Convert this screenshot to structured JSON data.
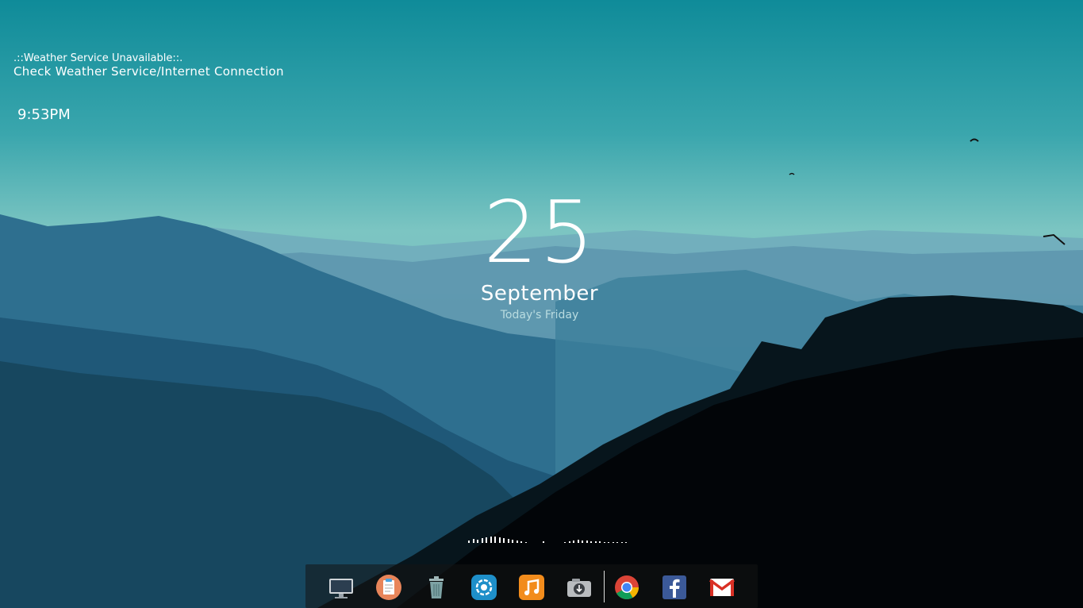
{
  "weather": {
    "status": ".::Weather Service Unavailable::.",
    "message": "Check Weather Service/Internet Connection"
  },
  "clock": {
    "time": "9:53PM"
  },
  "date": {
    "day": "25",
    "month": "September",
    "weekday": "Today's Friday"
  },
  "dock": {
    "items": [
      {
        "name": "desktop-icon"
      },
      {
        "name": "notes-icon"
      },
      {
        "name": "trash-icon"
      },
      {
        "name": "settings-flower-icon"
      },
      {
        "name": "music-icon"
      },
      {
        "name": "download-drive-icon"
      },
      {
        "name": "chrome-icon"
      },
      {
        "name": "facebook-icon"
      },
      {
        "name": "gmail-icon"
      }
    ]
  },
  "colors": {
    "accent": "#3aa6ad",
    "dock_bg": "#141414",
    "music_orange": "#f28c1c",
    "facebook_blue": "#3b5998",
    "gmail_red": "#d93025"
  }
}
